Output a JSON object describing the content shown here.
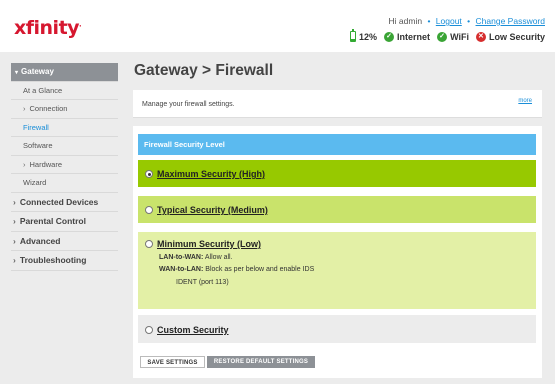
{
  "brand": {
    "logo": "xfinity",
    "logo_color": "#d6172f"
  },
  "header": {
    "greeting": "Hi admin",
    "logout": "Logout",
    "change_password": "Change Password",
    "status": {
      "battery": "12%",
      "internet": "Internet",
      "wifi": "WiFi",
      "security": "Low Security"
    }
  },
  "sidebar": {
    "gateway": "Gateway",
    "at_a_glance": "At a Glance",
    "connection": "Connection",
    "firewall": "Firewall",
    "software": "Software",
    "hardware": "Hardware",
    "wizard": "Wizard",
    "connected_devices": "Connected Devices",
    "parental_control": "Parental Control",
    "advanced": "Advanced",
    "troubleshooting": "Troubleshooting"
  },
  "main": {
    "title": "Gateway > Firewall",
    "description": "Manage your firewall settings.",
    "more": "more",
    "section_title": "Firewall Security Level",
    "options": {
      "maximum": "Maximum Security (High)",
      "typical": "Typical Security (Medium)",
      "minimum": "Minimum Security (Low)",
      "custom": "Custom Security"
    },
    "selected_option": "maximum",
    "minimum_details": {
      "lan_to_wan_label": "LAN-to-WAN:",
      "lan_to_wan_value": "Allow all.",
      "wan_to_lan_label": "WAN-to-LAN:",
      "wan_to_lan_value": "Block as per below and enable IDS",
      "ident": "IDENT (port 113)"
    },
    "buttons": {
      "save": "SAVE SETTINGS",
      "restore": "RESTORE DEFAULT SETTINGS"
    }
  },
  "colors": {
    "accent_blue": "#5bbaef",
    "maximum_bg": "#97c900",
    "typical_bg": "#c9e36b",
    "minimum_bg": "#e3f0a6",
    "custom_bg": "#ececec"
  }
}
